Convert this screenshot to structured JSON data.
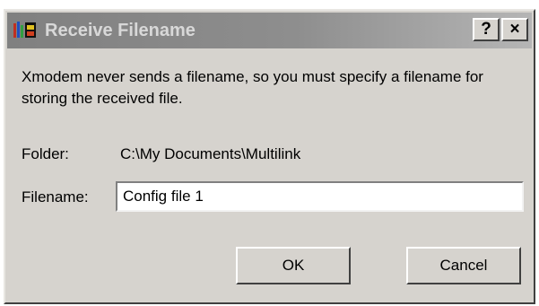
{
  "dialog": {
    "title": "Receive Filename",
    "help_button": "?",
    "close_button": "×",
    "message": "Xmodem never sends a filename, so you must specify a filename for storing the received file.",
    "folder_label": "Folder:",
    "folder_value": "C:\\My Documents\\Multilink",
    "filename_label": "Filename:",
    "filename_value": "Config file 1",
    "ok_label": "OK",
    "cancel_label": "Cancel"
  },
  "colors": {
    "face": "#d6d3ce",
    "title_inactive_start": "#808080",
    "title_inactive_end": "#b5b5b5",
    "title_text": "#d8d8d8"
  },
  "icons": {
    "app": "multilink-app-icon",
    "help": "help-icon",
    "close": "close-icon"
  }
}
